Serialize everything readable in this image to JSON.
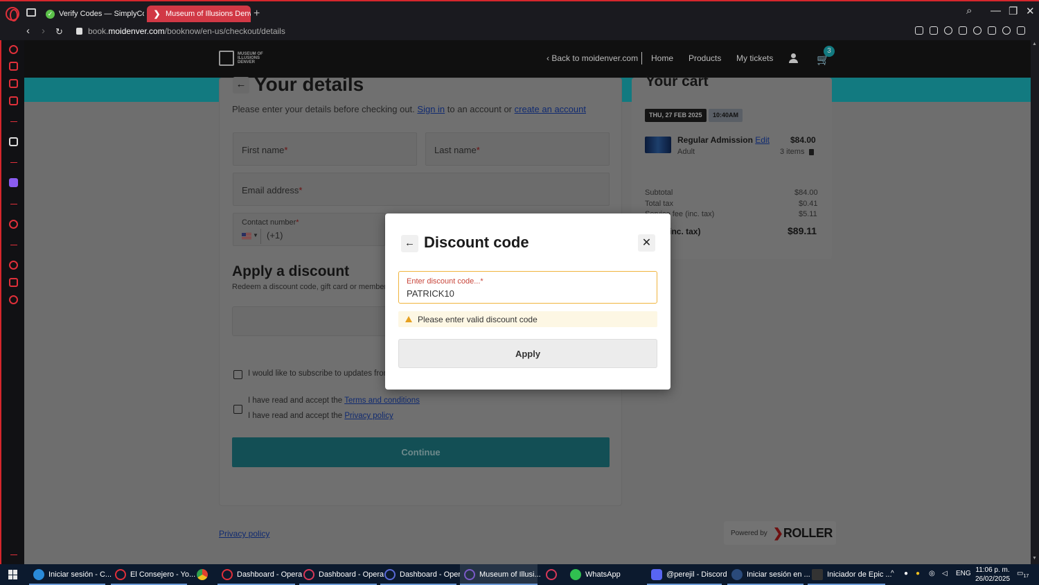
{
  "browser": {
    "tabs": [
      {
        "title": "Verify Codes — SimplyCo"
      },
      {
        "title": "Museum of Illusions Denv"
      }
    ],
    "new_tab": "+",
    "url_prefix": "book.",
    "url_domain": "moidenver.com",
    "url_path": "/booknow/en-us/checkout/details"
  },
  "site_header": {
    "logo_lines": [
      "MUSEUM OF",
      "ILLUSIONS",
      "DENVER"
    ],
    "back_link": "Back to moidenver.com",
    "nav": [
      "Home",
      "Products",
      "My tickets"
    ],
    "cart_count": "3"
  },
  "details": {
    "title": "Your details",
    "intro_before": "Please enter your details before checking out.",
    "sign_in": "Sign in",
    "intro_mid": "to an account or",
    "create_account": "create an account",
    "first_name": "First name",
    "last_name": "Last name",
    "email": "Email address",
    "contact": "Contact number",
    "required_mark": "*",
    "dial_code": "(+1)"
  },
  "discount_section": {
    "title": "Apply a discount",
    "subtitle": "Redeem a discount code, gift card or member"
  },
  "consents": {
    "subscribe": "I would like to subscribe to updates from",
    "terms_prefix": "I have read and accept the",
    "terms_link": "Terms and conditions",
    "privacy_prefix": "I have read and accept the",
    "privacy_link": "Privacy policy"
  },
  "continue_label": "Continue",
  "footer": {
    "privacy": "Privacy policy",
    "powered_by": "Powered by",
    "brand": "ROLLER"
  },
  "cart": {
    "title": "Your cart",
    "date": "THU, 27 FEB 2025",
    "time": "10:40AM",
    "item_name": "Regular Admission",
    "edit": "Edit",
    "item_type": "Adult",
    "item_price": "$84.00",
    "item_qty": "3 items",
    "subtotal_label": "Subtotal",
    "subtotal": "$84.00",
    "tax_label": "Total tax",
    "tax": "$0.41",
    "fee_label": "Service fee (inc. tax)",
    "fee": "$5.11",
    "total_label": "Total (inc. tax)",
    "total": "$89.11"
  },
  "modal": {
    "title": "Discount code",
    "input_label": "Enter discount code...",
    "required_mark": "*",
    "input_value": "PATRICK10",
    "error": "Please enter valid discount code",
    "apply": "Apply"
  },
  "taskbar": {
    "items": [
      {
        "label": "Iniciar sesión - C..."
      },
      {
        "label": "El Consejero - Yo..."
      },
      {
        "label": "Dashboard - Opera"
      },
      {
        "label": "Dashboard - Opera"
      },
      {
        "label": "Dashboard - Opera"
      },
      {
        "label": "Museum of Illusi..."
      },
      {
        "label": "WhatsApp"
      },
      {
        "label": "@perejil - Discord"
      },
      {
        "label": "Iniciar sesión en ..."
      },
      {
        "label": "Iniciador de Epic ..."
      }
    ],
    "lang": "ENG",
    "time": "11:06 p. m.",
    "date": "26/02/2025",
    "notif": "17"
  },
  "colors": {
    "accent_teal": "#127a80",
    "opera_red": "#e0303a",
    "error_text": "#c8453a",
    "warning_border": "#f0b43c"
  }
}
